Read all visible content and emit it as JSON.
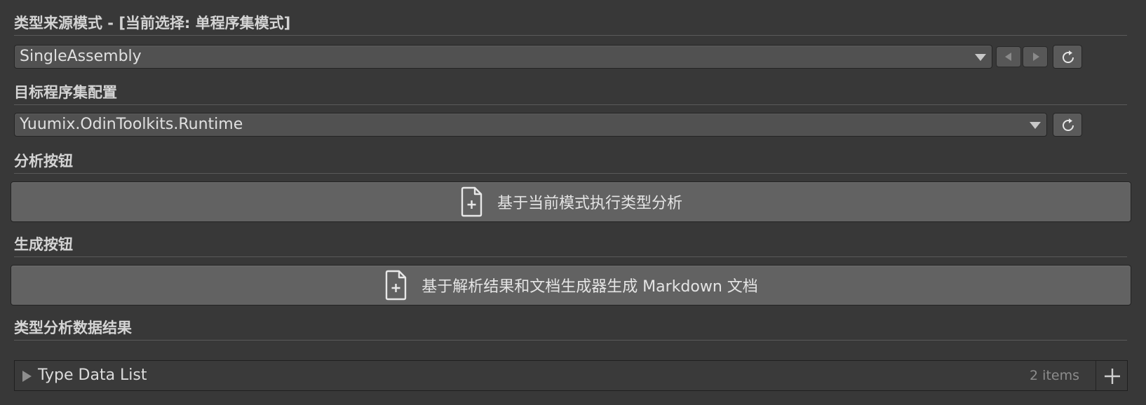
{
  "sections": {
    "type_source": {
      "header": "类型来源模式 - [当前选择: 单程序集模式]",
      "dropdown_value": "SingleAssembly"
    },
    "target_assembly": {
      "header": "目标程序集配置",
      "dropdown_value": "Yuumix.OdinToolkits.Runtime"
    },
    "analyze": {
      "header": "分析按钮",
      "button_label": "基于当前模式执行类型分析"
    },
    "generate": {
      "header": "生成按钮",
      "button_label": "基于解析结果和文档生成器生成 Markdown 文档"
    },
    "results": {
      "header": "类型分析数据结果",
      "list_title": "Type Data List",
      "list_count": "2 items"
    }
  },
  "icons": {
    "refresh": "refresh-icon",
    "prev": "arrow-left-icon",
    "next": "arrow-right-icon",
    "file_add": "file-add-icon",
    "expand": "expand-triangle-icon",
    "add": "plus-icon"
  },
  "colors": {
    "background": "#383838",
    "button": "#626262",
    "field": "#515151",
    "text": "#e0e0e0"
  }
}
